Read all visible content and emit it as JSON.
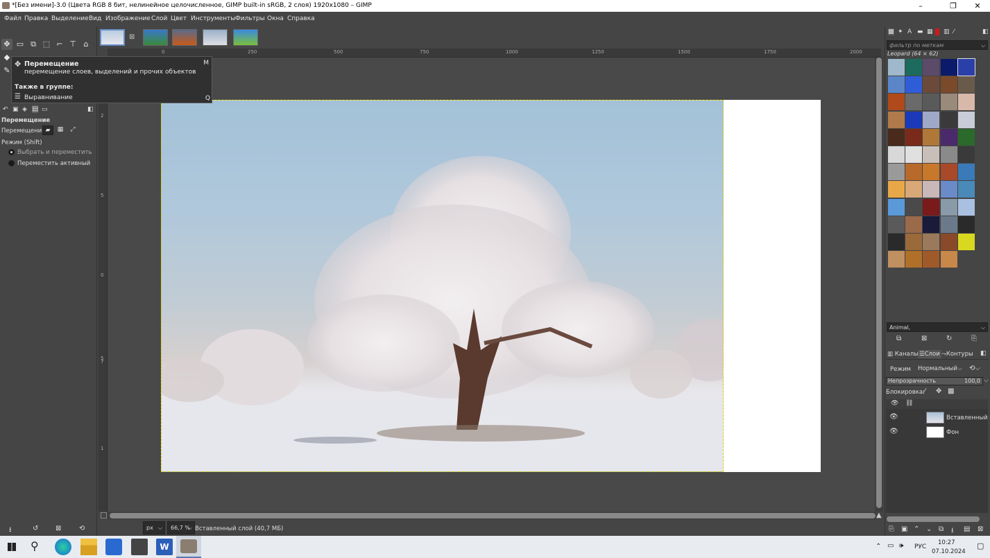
{
  "window": {
    "title": "*[Без имени]-3.0 (Цвета RGB 8 бит, нелинейное целочисленное, GIMP built-in sRGB, 2 слоя) 1920x1080 – GIMP",
    "minimize_glyph": "–",
    "maximize_glyph": "❐",
    "close_glyph": "✕"
  },
  "menu": [
    "Файл",
    "Правка",
    "Выделение",
    "Вид",
    "Изображение",
    "Слой",
    "Цвет",
    "Инструменты",
    "Фильтры",
    "Окна",
    "Справка"
  ],
  "tooltip": {
    "title": "Перемещение",
    "description": "перемещение слоев, выделений и прочих объектов",
    "shortcut": "M",
    "group_header": "Также в группе:",
    "group_item": "Выравнивание",
    "group_shortcut": "Q"
  },
  "tool_options": {
    "title": "Перемещение",
    "move_label": "Перемещение:",
    "mode_label": "Режим (Shift)",
    "option1": "Выбрать и переместить",
    "option2": "Переместить активный"
  },
  "ruler": {
    "h_ticks": [
      "0",
      "250",
      "500",
      "750",
      "1000",
      "1250",
      "1500",
      "1750",
      "2000"
    ],
    "v_ticks": [
      "2",
      "5",
      "0",
      "5",
      "7",
      "1"
    ]
  },
  "status": {
    "unit": "px",
    "zoom": "66,7 %",
    "layer_info": "Вставленный слой (40,7 МБ)"
  },
  "patterns": {
    "filter_placeholder": "фильтр по меткам",
    "selected_name": "Leopard (64 × 62)",
    "tags_value": "Animal,",
    "colors": [
      "#9fb8cb",
      "#1d6b5e",
      "#5c4a6a",
      "#0c1a6a",
      "#2b3fa8",
      "#5a86c8",
      "#2f5dd8",
      "#6b4a3a",
      "#7a4a2a",
      "#6a5a4a",
      "#b04a1a",
      "#6a6a6a",
      "#5a5a5a",
      "#9a8a7a",
      "#d8b8a8",
      "#b07a4a",
      "#1a3ab8",
      "#a0a8c8",
      "#3a3a3a",
      "#c8ccd8",
      "#4a2a1a",
      "#7a2a1a",
      "#b07838",
      "#4a2a6a",
      "#2a6a2a",
      "#d8d8d8",
      "#e0e0e0",
      "#c8c0b8",
      "#8a8a8a",
      "#3a3a3a",
      "#9a9a9a",
      "#b86a2a",
      "#c8782a",
      "#a84a2a",
      "#3a7ab8",
      "#e8a848",
      "#d8a878",
      "#c8b8b8",
      "#6a8ac8",
      "#4a8ab8",
      "#5a9ad8",
      "#4a4a4a",
      "#7a1a1a",
      "#8a9aa8",
      "#aac0e0",
      "#5a5a5a",
      "#9a6a4a",
      "#1a1a3a",
      "#6a7a8a",
      "#2a2a2a",
      "#2a2a2a",
      "#9a6a3a",
      "#9a7a5a",
      "#8a4a2a",
      "#d8d820",
      "#c09060",
      "#b0702a",
      "#a05a2a",
      "#c8884a"
    ]
  },
  "layers_panel": {
    "tabs": [
      "Каналы",
      "Слои",
      "Контуры"
    ],
    "mode_label": "Режим",
    "mode_value": "Нормальный",
    "opacity_label": "Непрозрачность",
    "opacity_value": "100,0",
    "lock_label": "Блокировка:",
    "layers": [
      {
        "name": "Вставленный сл",
        "visible": true
      },
      {
        "name": "Фон",
        "visible": true
      }
    ]
  },
  "taskbar": {
    "language": "РУС",
    "time": "10:27",
    "date": "07.10.2024"
  }
}
